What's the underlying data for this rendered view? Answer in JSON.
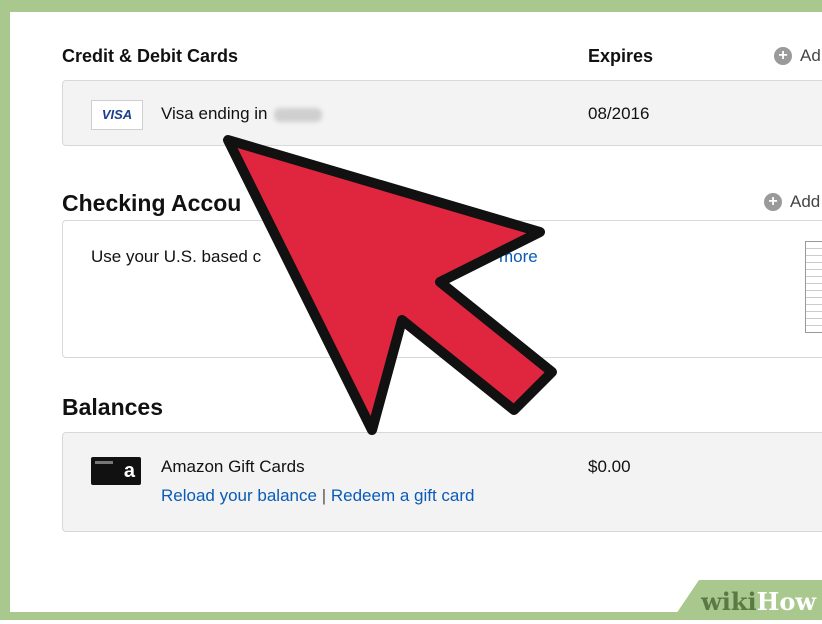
{
  "cards": {
    "header": "Credit & Debit Cards",
    "expires_header": "Expires",
    "add_label": "Ad",
    "row": {
      "brand": "VISA",
      "label": "Visa ending in",
      "expires": "08/2016"
    }
  },
  "checking": {
    "title": "Checking Accou",
    "add_label": "Add",
    "text_start": "Use your U.S. based c",
    "link": "more"
  },
  "balances": {
    "title": "Balances",
    "gift": {
      "logo": "a",
      "label": "Amazon Gift Cards",
      "amount": "$0.00",
      "reload_link": "Reload your balance",
      "separator": "|",
      "redeem_link": "Redeem a gift card"
    }
  },
  "watermark": {
    "part1": "wiki",
    "part2": "How"
  },
  "colors": {
    "frame": "#a8c88e",
    "arrow": "#e0263f",
    "link": "#0a5bb8"
  },
  "icons": [
    "plus-circle-icon",
    "visa-logo",
    "amazon-logo",
    "arrow-pointer"
  ]
}
